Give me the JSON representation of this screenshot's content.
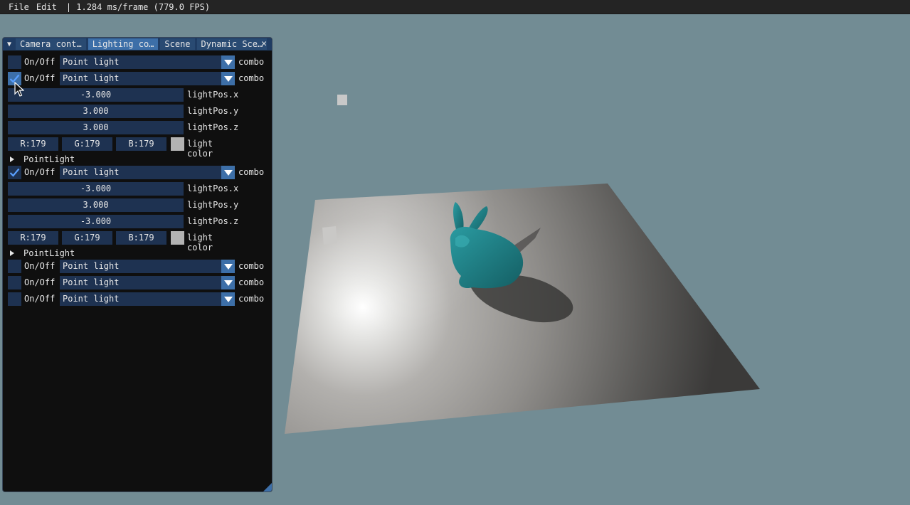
{
  "menubar": {
    "file": "File",
    "edit": "Edit",
    "stats": "| 1.284 ms/frame (779.0 FPS)"
  },
  "window": {
    "tabs": [
      "Camera cont…",
      "Lighting co…",
      "Scene",
      "Dynamic Sce…"
    ],
    "active_tab": 1,
    "close": "✕"
  },
  "labels": {
    "onoff": "On/Off",
    "combo": "combo",
    "light_color": "light color",
    "pos_x": "lightPos.x",
    "pos_y": "lightPos.y",
    "pos_z": "lightPos.z"
  },
  "lights": [
    {
      "checked": false,
      "type": "Point light"
    },
    {
      "checked": true,
      "type": "Point light",
      "pos_x": "-3.000",
      "pos_y": "3.000",
      "pos_z": "3.000",
      "r": "R:179",
      "g": "G:179",
      "b": "B:179",
      "tree_label": "PointLight"
    },
    {
      "checked": true,
      "type": "Point light",
      "pos_x": "-3.000",
      "pos_y": "3.000",
      "pos_z": "-3.000",
      "r": "R:179",
      "g": "G:179",
      "b": "B:179",
      "tree_label": "PointLight"
    },
    {
      "checked": false,
      "type": "Point light"
    },
    {
      "checked": false,
      "type": "Point light"
    },
    {
      "checked": false,
      "type": "Point light"
    }
  ],
  "colors": {
    "viewport_bg": "#728c94",
    "panel_bg": "#0f0f0f",
    "widget_bg": "#1e3251",
    "accent": "#3d6fa8",
    "bunny": "#1f7a80",
    "light_color": "#b3b3b3"
  }
}
